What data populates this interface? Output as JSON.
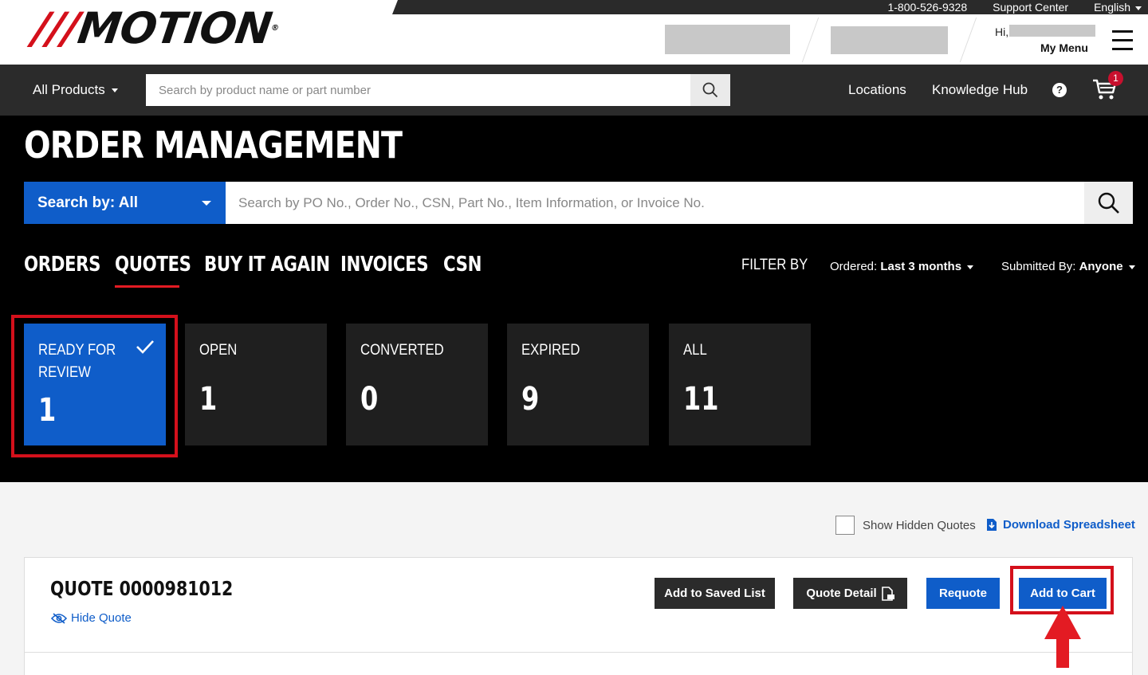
{
  "header": {
    "phone": "1-800-526-9328",
    "support": "Support Center",
    "language": "English",
    "logo_text": "MOTION",
    "greeting": "Hi,",
    "my_menu": "My Menu"
  },
  "nav": {
    "all_products": "All Products",
    "search_placeholder": "Search by product name or part number",
    "locations": "Locations",
    "knowledge_hub": "Knowledge Hub",
    "help_glyph": "?",
    "cart_count": "1"
  },
  "order_mgmt": {
    "title": "ORDER MANAGEMENT",
    "search_by": "Search by: All",
    "search_placeholder": "Search by PO No., Order No., CSN, Part No., Item Information, or Invoice No.",
    "tabs": [
      "ORDERS",
      "QUOTES",
      "BUY IT AGAIN",
      "INVOICES",
      "CSN"
    ],
    "active_tab": "QUOTES",
    "filter_by": "FILTER BY",
    "ordered_label": "Ordered:",
    "ordered_value": "Last 3 months",
    "submitted_label": "Submitted By:",
    "submitted_value": "Anyone"
  },
  "status_cards": [
    {
      "label": "READY FOR REVIEW",
      "count": "1",
      "active": true
    },
    {
      "label": "OPEN",
      "count": "1"
    },
    {
      "label": "CONVERTED",
      "count": "0"
    },
    {
      "label": "EXPIRED",
      "count": "9"
    },
    {
      "label": "ALL",
      "count": "11"
    }
  ],
  "list": {
    "show_hidden": "Show Hidden Quotes",
    "download": "Download Spreadsheet"
  },
  "quote": {
    "title": "QUOTE 0000981012",
    "hide": "Hide Quote",
    "add_saved": "Add to Saved List",
    "detail": "Quote Detail",
    "requote": "Requote",
    "add_cart": "Add to Cart"
  },
  "colors": {
    "brand_red": "#d4101b",
    "accent_blue": "#0f5dc9",
    "nav_bg": "#2b2b2b"
  }
}
